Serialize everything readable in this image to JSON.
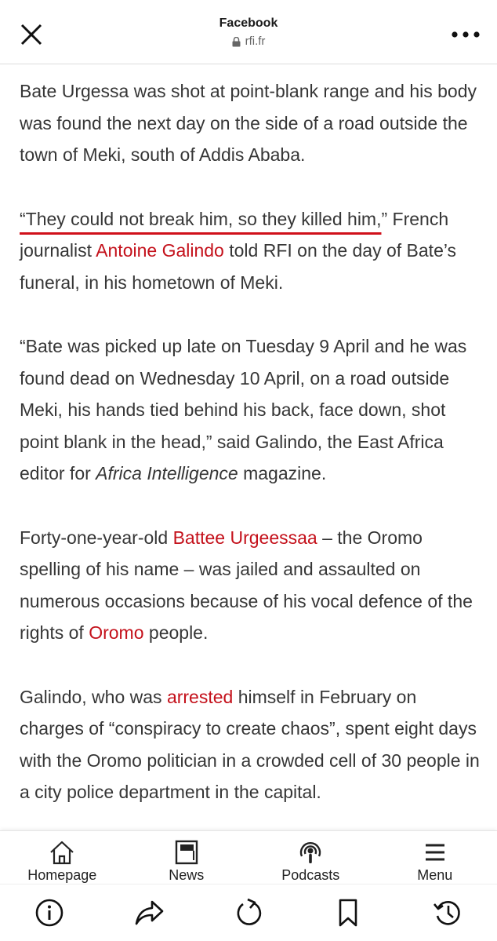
{
  "header": {
    "title": "Facebook",
    "domain": "rfi.fr",
    "close_icon": "close-icon",
    "lock_icon": "lock-icon",
    "more_icon": "more-options-icon"
  },
  "article": {
    "p1": "Bate Urgessa was shot at point-blank range and his body was found the next day on the side of a road outside the town of Meki, south of Addis Ababa.",
    "p2": {
      "quote": "“They could not break him, so they killed him,",
      "after_quote": "” French journalist ",
      "link": "Antoine Galindo",
      "rest": " told RFI on the day of Bate’s funeral, in his hometown of Meki."
    },
    "p3": {
      "text": "“Bate was picked up late on Tuesday 9 April and he was found dead on Wednesday 10 April, on a road outside Meki, his hands tied behind his back, face down, shot point blank in the head,” said Galindo, the East Africa editor for ",
      "italic": "Africa Intelligence",
      "end": " magazine."
    },
    "p4": {
      "start": "Forty-one-year-old ",
      "link1": "Battee Urgeessaa",
      "middle": " – the Oromo spelling of his name – was jailed and assaulted on numerous occasions because of his vocal defence of the rights of ",
      "link2": "Oromo",
      "end": " people."
    },
    "p5": {
      "start": "Galindo, who was ",
      "link": "arrested",
      "end": " himself in February on charges of “conspiracy to create chaos”, spent eight days with the Oromo politician in a crowded cell of 30 people in a city police department in the capital."
    }
  },
  "nav": {
    "items": [
      {
        "label": "Homepage",
        "icon": "home-icon"
      },
      {
        "label": "News",
        "icon": "news-icon"
      },
      {
        "label": "Podcasts",
        "icon": "podcast-icon"
      },
      {
        "label": "Menu",
        "icon": "menu-icon"
      }
    ]
  },
  "toolbar": {
    "icons": [
      "info-icon",
      "share-icon",
      "refresh-icon",
      "bookmark-icon",
      "history-icon"
    ]
  },
  "colors": {
    "link": "#c4111b",
    "text": "#363636",
    "underline": "#d0101a"
  }
}
